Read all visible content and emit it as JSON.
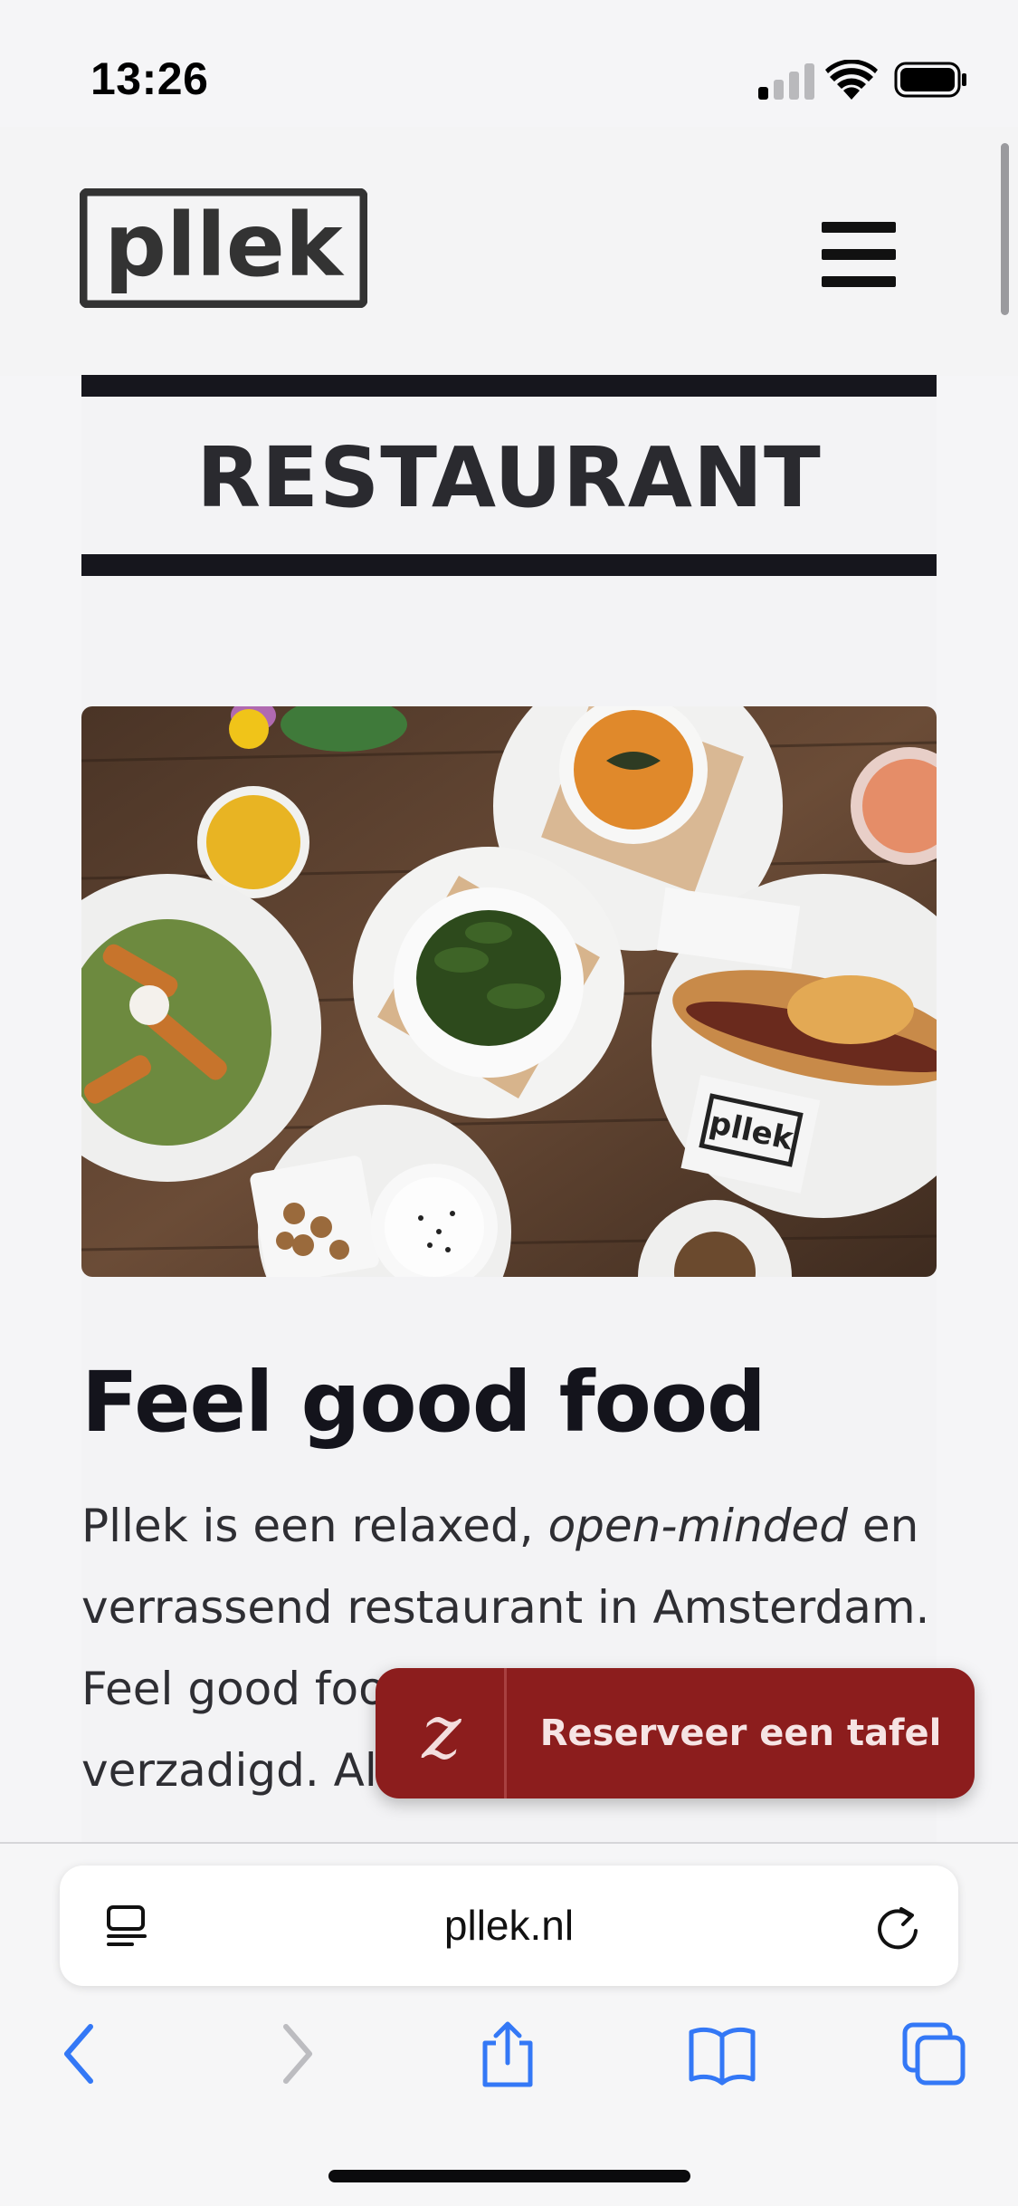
{
  "status_bar": {
    "time": "13:26"
  },
  "site": {
    "logo_text": "pllek",
    "menu_icon": "hamburger-menu-icon",
    "section_title": "RESTAURANT",
    "photo_brand_card": "pllek"
  },
  "article": {
    "heading": "Feel good food",
    "paragraph": {
      "part1": "Pllek is een relaxed, ",
      "italic": "open-minded",
      "part2": " en verrassend restaurant in Amsterdam. Feel good food voor gezond, verzadigd. Alles wat je bij ons eet"
    }
  },
  "reserve": {
    "icon": "zenchef-z-icon",
    "icon_glyph": "z",
    "label": "Reserveer een tafel"
  },
  "browser": {
    "url": "pllek.nl",
    "icons": [
      "page-menu-icon",
      "reload-icon",
      "back-icon",
      "forward-icon",
      "share-icon",
      "bookmarks-icon",
      "tabs-icon"
    ]
  },
  "colors": {
    "accent_red": "#8c1d1d",
    "ios_blue": "#3478f6",
    "dark": "#16161d"
  }
}
